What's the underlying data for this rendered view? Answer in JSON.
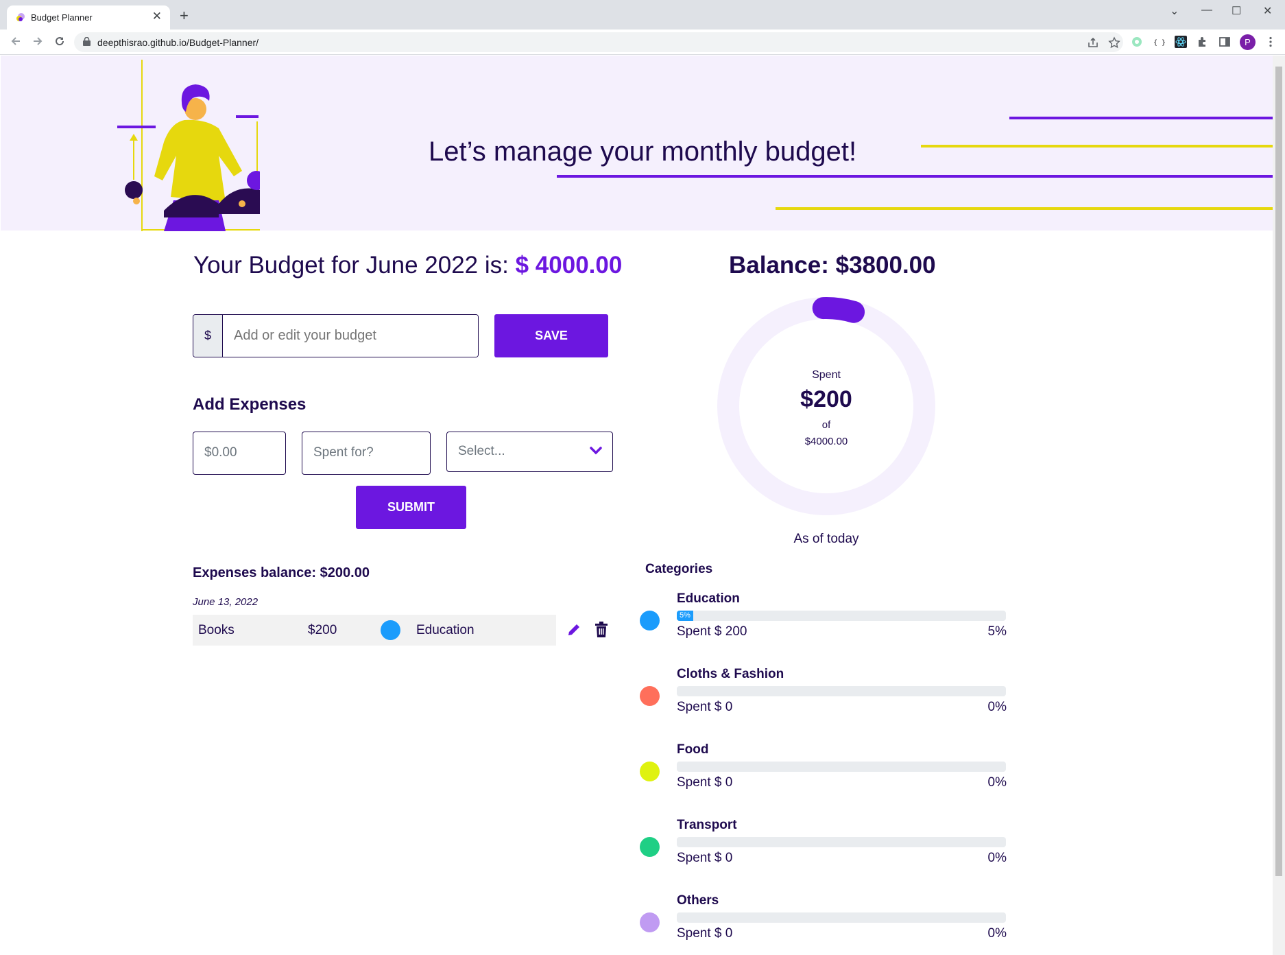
{
  "browser": {
    "tab_title": "Budget Planner",
    "tab_close": "✕",
    "new_tab": "+",
    "url": "deepthisrao.github.io/Budget-Planner/",
    "profile_initial": "P",
    "window_controls": [
      "⌄",
      "—",
      "☐",
      "✕"
    ]
  },
  "hero": {
    "title": "Let’s manage your monthly budget!"
  },
  "budget": {
    "prefix": "Your Budget for June 2022 is: ",
    "amount": "$ 4000.00",
    "currency_symbol": "$",
    "input_placeholder": "Add or edit your budget",
    "save_label": "SAVE"
  },
  "balance": {
    "text": "Balance: $3800.00"
  },
  "expenses_form": {
    "title": "Add Expenses",
    "amount_placeholder": "$0.00",
    "spent_for_placeholder": "Spent for?",
    "select_placeholder": "Select...",
    "submit_label": "SUBMIT"
  },
  "expenses_list": {
    "balance_text": "Expenses balance: $200.00",
    "groups": [
      {
        "date": "June 13, 2022",
        "items": [
          {
            "description": "Books",
            "amount": "$200",
            "category": "Education",
            "category_color": "#1b9cfc"
          }
        ]
      }
    ]
  },
  "summary": {
    "spent_label": "Spent",
    "spent_amount": "$200",
    "of_label": "of",
    "total": "$4000.00",
    "as_of": "As of today",
    "spent_fraction": 0.05
  },
  "categories": {
    "title": "Categories",
    "items": [
      {
        "name": "Education",
        "spent": "Spent $ 200",
        "percent_text": "5%",
        "percent": 5,
        "bar_label": "5%",
        "color": "#1b9cfc"
      },
      {
        "name": "Cloths & Fashion",
        "spent": "Spent $ 0",
        "percent_text": "0%",
        "percent": 0,
        "bar_label": "",
        "color": "#ff6f5b"
      },
      {
        "name": "Food",
        "spent": "Spent $ 0",
        "percent_text": "0%",
        "percent": 0,
        "bar_label": "",
        "color": "#dff20f"
      },
      {
        "name": "Transport",
        "spent": "Spent $ 0",
        "percent_text": "0%",
        "percent": 0,
        "bar_label": "",
        "color": "#1fcf85"
      },
      {
        "name": "Others",
        "spent": "Spent $ 0",
        "percent_text": "0%",
        "percent": 0,
        "bar_label": "",
        "color": "#c09bf2"
      }
    ]
  },
  "colors": {
    "accent": "#6c17e0",
    "text_dark": "#1e0a4e",
    "hero_bg": "#f5f0fd",
    "yellow": "#e6d80e"
  }
}
